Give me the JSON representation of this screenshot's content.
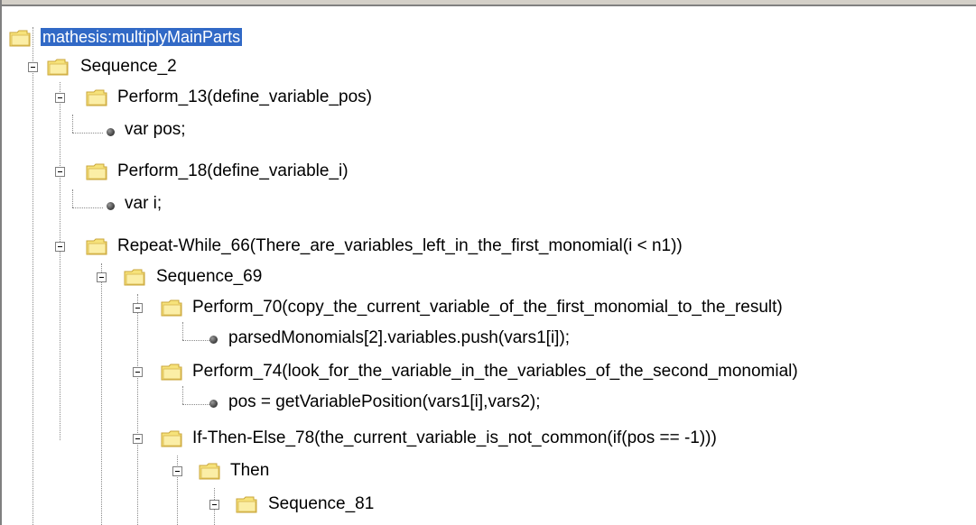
{
  "tree": {
    "root_label": "mathesis:multiplyMainParts",
    "nodes": [
      {
        "label": "Sequence_2",
        "type": "folder"
      },
      {
        "label": "Perform_13(define_variable_pos)",
        "type": "folder"
      },
      {
        "label": "var pos;",
        "type": "leaf"
      },
      {
        "label": "Perform_18(define_variable_i)",
        "type": "folder"
      },
      {
        "label": "var i;",
        "type": "leaf"
      },
      {
        "label": "Repeat-While_66(There_are_variables_left_in_the_first_monomial(i < n1))",
        "type": "folder"
      },
      {
        "label": "Sequence_69",
        "type": "folder"
      },
      {
        "label": "Perform_70(copy_the_current_variable_of_the_first_monomial_to_the_result)",
        "type": "folder"
      },
      {
        "label": "parsedMonomials[2].variables.push(vars1[i]);",
        "type": "leaf"
      },
      {
        "label": "Perform_74(look_for_the_variable_in_the_variables_of_the_second_monomial)",
        "type": "folder"
      },
      {
        "label": "pos = getVariablePosition(vars1[i],vars2);",
        "type": "leaf"
      },
      {
        "label": "If-Then-Else_78(the_current_variable_is_not_common(if(pos == -1)))",
        "type": "folder"
      },
      {
        "label": "Then",
        "type": "folder"
      },
      {
        "label": "Sequence_81",
        "type": "folder"
      }
    ]
  },
  "colors": {
    "selection": "#3169c6",
    "folder_fill": "#f6e27a",
    "folder_edge": "#c9a63a"
  },
  "icons": {
    "expanded": "minus-box-icon",
    "node": "folder-icon",
    "leaf": "bullet-icon"
  }
}
